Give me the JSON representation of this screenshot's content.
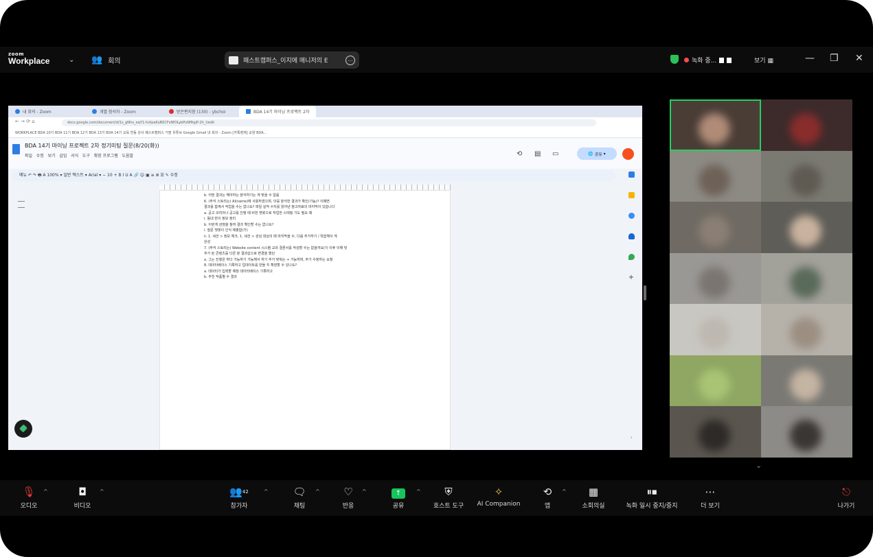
{
  "topbar": {
    "logo_small": "zoom",
    "logo_large": "Workplace",
    "meeting_menu": "회의",
    "window_title": "패스트캠퍼스_이지에 매니저의 E",
    "recording": "녹화 중...",
    "view": "보기"
  },
  "browser": {
    "tabs": [
      "내 회의 - Zoom",
      "개별 참석자 - Zoom",
      "받은편지함 (130) - ybchoi",
      "BDA 14기 마이닝 프로젝트 2차"
    ],
    "address": "docs.google.com/document/d/1s_gNhx_eqY1-fuVpaKuB0CFsNfOLybPuNfRqjP-2h_I/edit",
    "bookmarks": "WORKPLACE   BDA 10기   BDA 11기   BDA 12기   BDA 13기   BDA 14기   교육 연동   강사   패스트캠퍼스   거점   유튜브   Google   Gmail   내 회의 - Zoom   [카톡영재] 교양 BDA..."
  },
  "docs": {
    "title": "BDA 14기 마이닝 프로젝트 2차 정기미팅 질문(8/20(화))",
    "menu": [
      "파일",
      "수정",
      "보기",
      "삽입",
      "서식",
      "도구",
      "확장 프로그램",
      "도움말"
    ],
    "toolbar": "메뉴   ↶  ↷  🖶  A  100%  ▾   일반 텍스트 ▾   Arial ▾   −  10  +   B  I  U  A   🔗  ☺  ▣   ≡  ≣  ☰  ✎ 수정",
    "share_label": "공유",
    "body_lines": [
      "b.   어떤 결과는 해야하는 분석하기는 게 맞을 수 없음",
      "6.   (주석 스토리는) AI(name)에 사용하였으며, 이를 분석한 결과가 확인(가능)? 이때면",
      "     결과를 함께서 작업을 수는 없나요? 파일 실적 수치를 읽어낸 참고자료의 마지막이 있습니다",
      "     a.   공고 코리아나 공고를 진행 때 비한 챗봇으로 작업한 스테핑 기도 필요 때",
      "          i.    동네 만이 정보 정리",
      "     b.   이런게 관점을 참여 결과 확인할 수는 없나요?",
      "          i.    질문 챗봇이 인식 제출함(가)",
      "          ii.   1. 세션 > 정보 체크, 1. 세션 > 관심 대상의 때 마지막을 수, 다음 추가하기 / 학습해서 게",
      "               완성",
      "7.   (주석 스토리는) Website content 시스템 교과 결론서를 작성할 수는 없을까요(?) 이후 이해 및",
      "     추가 된 콘텐츠를 다른 분 결과값으로 변경을 했던",
      "     a.   그는 진행은 하다 가능하기 가능해서 하기 추가 맞춰는 + 가능하며, 주기 수정하는 요청",
      "8.   데이터베이스 기록하고 업데이트를 만들 지 확장할 수 있나요?",
      "     a.   데이터가 입력할 예정 데이터베이스 기록하고",
      "     b.   추천 작품별 수 결과"
    ]
  },
  "controls": [
    {
      "label": "오디오",
      "icon": "mic-off-icon"
    },
    {
      "label": "비디오",
      "icon": "video-icon"
    },
    {
      "label": "참가자",
      "icon": "participants-icon",
      "badge": "42"
    },
    {
      "label": "채팅",
      "icon": "chat-icon"
    },
    {
      "label": "반응",
      "icon": "heart-icon"
    },
    {
      "label": "공유",
      "icon": "share-icon"
    },
    {
      "label": "호스트 도구",
      "icon": "shield-icon"
    },
    {
      "label": "AI Companion",
      "icon": "sparkle-icon"
    },
    {
      "label": "앱",
      "icon": "apps-icon"
    },
    {
      "label": "소회의실",
      "icon": "grid-icon"
    },
    {
      "label": "녹화 일시 중지/중지",
      "icon": "pause-stop-icon"
    },
    {
      "label": "더 보기",
      "icon": "more-icon"
    },
    {
      "label": "나가기",
      "icon": "leave-icon"
    }
  ],
  "colors": {
    "background": "#000000",
    "accent_green": "#23D160",
    "record_red": "#FF4B4B",
    "docs_blue": "#2F7DE4"
  }
}
